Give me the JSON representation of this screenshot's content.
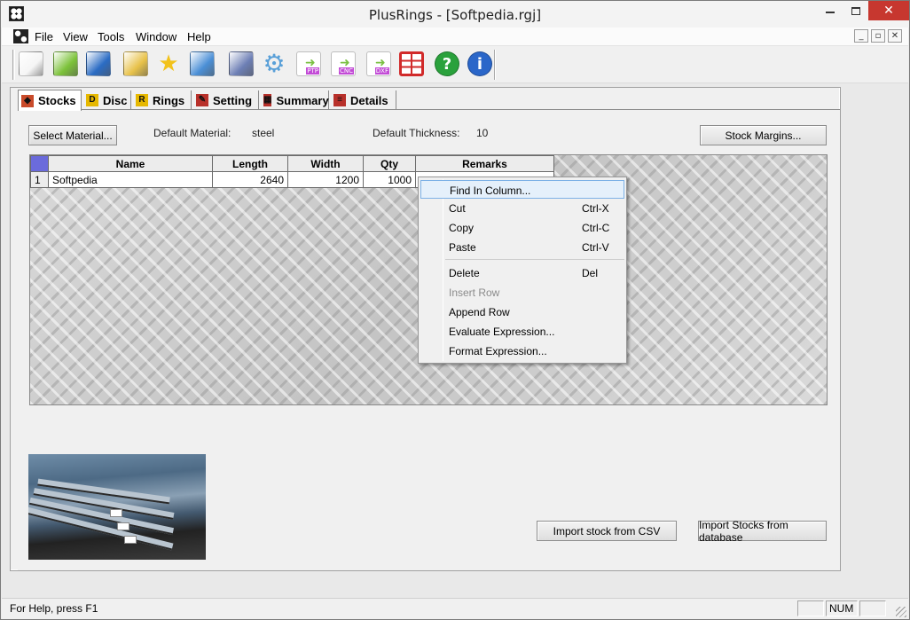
{
  "window": {
    "title": "PlusRings - [Softpedia.rgj]"
  },
  "menu": {
    "items": [
      "File",
      "View",
      "Tools",
      "Window",
      "Help"
    ]
  },
  "toolbar": {
    "buttons": [
      {
        "icon": "new-document-icon",
        "color": "#f5f5f5"
      },
      {
        "icon": "open-folder-icon",
        "color": "#7cc23a"
      },
      {
        "icon": "save-disk-icon",
        "color": "#2b6cc4"
      },
      {
        "icon": "lock-icon",
        "color": "#e8c24a"
      },
      {
        "icon": "star-icon",
        "color": "#f2c21b"
      },
      {
        "icon": "palette-icon",
        "color": "#4b8fd6"
      },
      {
        "icon": "checklist-icon",
        "color": "#6d7fb5"
      },
      {
        "icon": "gear-icon",
        "color": "#5aa0d8"
      },
      {
        "icon": "ptp-export-icon",
        "color": "#7bc043"
      },
      {
        "icon": "cnc-export-icon",
        "color": "#7bc043"
      },
      {
        "icon": "dxf-export-icon",
        "color": "#7bc043"
      },
      {
        "icon": "grid-layout-icon",
        "color": "#d12a2a"
      },
      {
        "icon": "help-icon",
        "color": "#2aa13c"
      },
      {
        "icon": "info-icon",
        "color": "#2a66c9"
      }
    ],
    "export_labels": [
      "PTP",
      "CNC",
      "DXF"
    ]
  },
  "tabs": [
    {
      "label": "Stocks",
      "icon": "stocks-tab-icon",
      "glyph": "◆",
      "color": "#c84a2a"
    },
    {
      "label": "Disc",
      "icon": "disc-tab-icon",
      "glyph": "D",
      "color": "#e6b800"
    },
    {
      "label": "Rings",
      "icon": "rings-tab-icon",
      "glyph": "R",
      "color": "#e6b800"
    },
    {
      "label": "Setting",
      "icon": "setting-tab-icon",
      "glyph": "✎",
      "color": "#b8302a"
    },
    {
      "label": "Summary",
      "icon": "summary-tab-icon",
      "glyph": "▦",
      "color": "#b8302a"
    },
    {
      "label": "Details",
      "icon": "details-tab-icon",
      "glyph": "≡",
      "color": "#b8302a"
    }
  ],
  "stocks": {
    "select_material_label": "Select Material...",
    "default_material_label": "Default Material:",
    "default_material_value": "steel",
    "default_thickness_label": "Default Thickness:",
    "default_thickness_value": "10",
    "stock_margins_label": "Stock Margins...",
    "import_csv_label": "Import stock from CSV",
    "import_db_label": "Import Stocks from database"
  },
  "grid": {
    "columns": [
      "Name",
      "Length",
      "Width",
      "Qty",
      "Remarks"
    ],
    "rows": [
      {
        "num": "1",
        "name": "Softpedia",
        "length": "2640",
        "width": "1200",
        "qty": "1000",
        "remarks": ""
      }
    ]
  },
  "context_menu": {
    "items": [
      {
        "label": "Find In Column...",
        "shortcut": "",
        "state": "highlighted"
      },
      {
        "label": "Cut",
        "shortcut": "Ctrl-X",
        "state": "normal"
      },
      {
        "label": "Copy",
        "shortcut": "Ctrl-C",
        "state": "normal"
      },
      {
        "label": "Paste",
        "shortcut": "Ctrl-V",
        "state": "normal"
      },
      {
        "label": "Delete",
        "shortcut": "Del",
        "state": "normal"
      },
      {
        "label": "Insert Row",
        "shortcut": "",
        "state": "disabled"
      },
      {
        "label": "Append Row",
        "shortcut": "",
        "state": "normal"
      },
      {
        "label": "Evaluate Expression...",
        "shortcut": "",
        "state": "normal"
      },
      {
        "label": "Format Expression...",
        "shortcut": "",
        "state": "normal"
      }
    ]
  },
  "status": {
    "help_text": "For Help, press F1",
    "num_indicator": "NUM"
  }
}
